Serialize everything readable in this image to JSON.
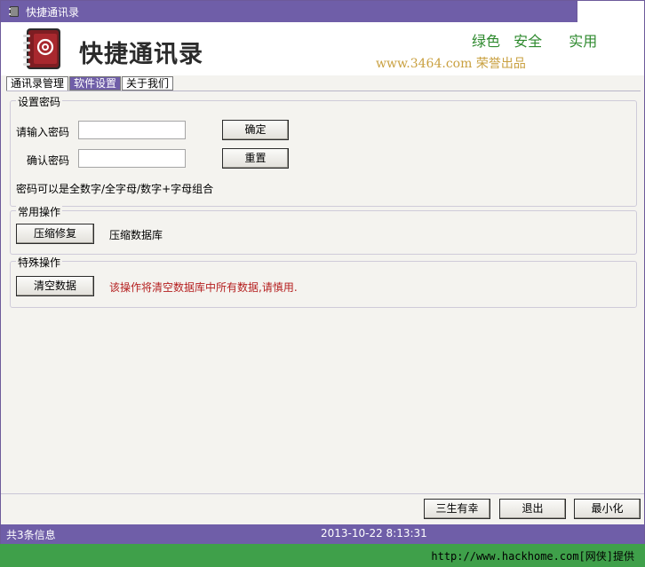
{
  "window": {
    "title": "快捷通讯录"
  },
  "banner": {
    "app_name": "快捷通讯录",
    "slogan": "绿色 安全  实用",
    "site": "www.3464.com 荣誉出品"
  },
  "tabs": [
    {
      "label": "通讯录管理",
      "selected": true
    },
    {
      "label": "软件设置",
      "selected": false
    },
    {
      "label": "关于我们",
      "selected": false
    }
  ],
  "password": {
    "title": "设置密码",
    "enter_label": "请输入密码",
    "confirm_label": "确认密码",
    "enter_value": "",
    "confirm_value": "",
    "ok_button": "确定",
    "reset_button": "重置",
    "hint": "密码可以是全数字/全字母/数字+字母组合"
  },
  "common_ops": {
    "title": "常用操作",
    "compress_button": "压缩修复",
    "compress_desc": "压缩数据库"
  },
  "special_ops": {
    "title": "特殊操作",
    "clear_button": "清空数据",
    "clear_warning": "该操作将清空数据库中所有数据,请慎用."
  },
  "footer": {
    "btn_about": "三生有幸",
    "btn_exit": "退出",
    "btn_minimize": "最小化"
  },
  "status": {
    "count": "共3条信息",
    "datetime": "2013-10-22 8:13:31"
  },
  "source_credit": "http://www.hackhome.com[网侠]提供",
  "colors": {
    "title_bar": "#6f5ea8",
    "warning": "#b52020",
    "slogan": "#2f8a2f",
    "site": "#c9a040",
    "credit_bar": "#3fa04a"
  }
}
